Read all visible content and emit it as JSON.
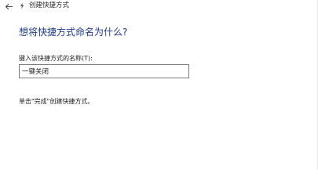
{
  "window": {
    "title": "创建快捷方式"
  },
  "navigation": {
    "back_icon": "arrow-left-icon"
  },
  "main": {
    "heading": "想将快捷方式命名为什么?",
    "name_label": "键入该快捷方式的名称(T):",
    "name_value": "一键关闭",
    "finish_hint": "单击\"完成\"创建快捷方式。"
  },
  "colors": {
    "heading": "#1d3b8a",
    "text": "#222222",
    "input_border": "#7a7a7a",
    "background": "#ffffff"
  }
}
